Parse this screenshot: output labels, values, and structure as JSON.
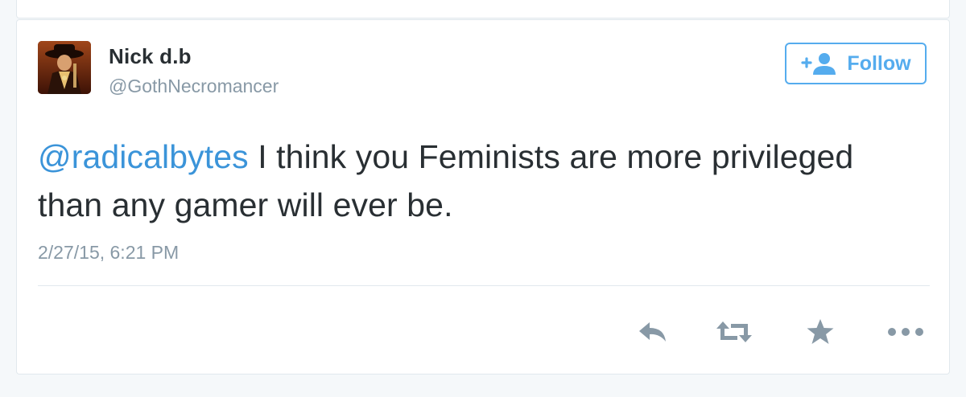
{
  "tweet": {
    "author": {
      "display_name": "Nick d.b",
      "screen_name": "@GothNecromancer"
    },
    "follow_button": {
      "label": "Follow"
    },
    "text": {
      "mention": "@radicalbytes",
      "body": " I think you Feminists are more privileged than any gamer will ever be."
    },
    "timestamp": "2/27/15, 6:21 PM"
  },
  "icons": {
    "follow": "add-user-icon",
    "reply": "reply-icon",
    "retweet": "retweet-icon",
    "favorite": "star-icon",
    "more": "more-dots-icon"
  },
  "colors": {
    "accent": "#55acee",
    "link": "#3b94d9",
    "text": "#292f33",
    "muted": "#8899a6",
    "action_icon": "#8899a6",
    "border": "#e1e8ed",
    "background": "#f5f8fa"
  }
}
